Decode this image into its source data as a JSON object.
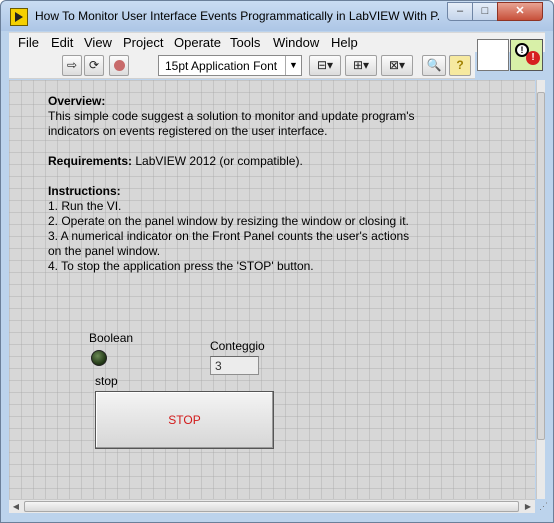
{
  "window": {
    "title": "How To Monitor User Interface Events Programmatically in LabVIEW With P...",
    "minimize": "–",
    "maximize": "□",
    "close": "✕"
  },
  "menu": {
    "items": [
      "File",
      "Edit",
      "View",
      "Project",
      "Operate",
      "Tools",
      "Window",
      "Help"
    ]
  },
  "toolbar": {
    "run_icon": "run-arrow-icon",
    "run_continuous_icon": "run-continuously-icon",
    "abort_icon": "abort-execution-icon",
    "font": "15pt Application Font",
    "align_icon": "align-objects-icon",
    "distribute_icon": "distribute-objects-icon",
    "resize_icon": "resize-objects-icon",
    "search_icon": "search-icon",
    "help_icon": "context-help-icon",
    "help_label": "?",
    "search_label": "🔍"
  },
  "panel": {
    "overview_heading": "Overview:",
    "overview_line1": "This simple code suggest a solution to monitor and update program's",
    "overview_line2": "indicators on events registered on the user interface.",
    "requirements_heading": "Requirements:",
    "requirements_text": " LabVIEW 2012 (or compatible).",
    "instructions_heading": "Instructions:",
    "instructions": [
      "1. Run the VI.",
      "2. Operate on the panel window by resizing the window or closing it.",
      "3. A numerical indicator on the Front Panel counts the user's actions",
      "on the panel window.",
      "4. To stop the application press the 'STOP' button."
    ],
    "boolean_label": "Boolean",
    "boolean_state": "off",
    "count_label": "Conteggio",
    "count_value": "3",
    "stop_label": "stop",
    "stop_text": "STOP"
  },
  "colors": {
    "panel_bg": "#d7d7d7",
    "stop_text": "#d21a1a",
    "led_off": "#1e3313"
  }
}
